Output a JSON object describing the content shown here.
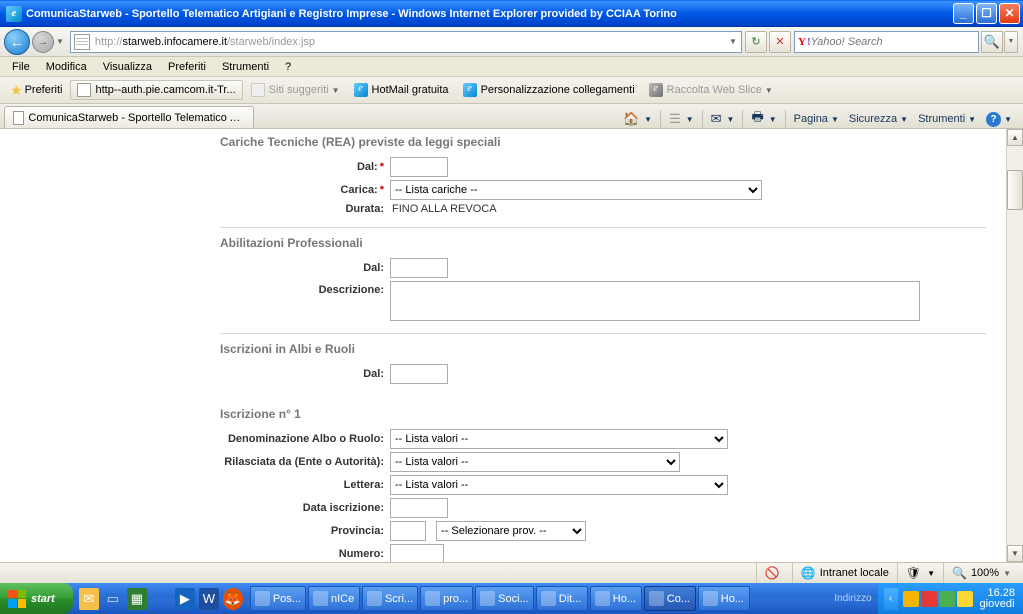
{
  "window": {
    "title": "ComunicaStarweb - Sportello Telematico Artigiani e Registro Imprese - Windows Internet Explorer provided by CCIAA Torino"
  },
  "address": {
    "scheme": "http://",
    "host": "starweb.infocamere.it",
    "path": "/starweb/index.jsp"
  },
  "search": {
    "placeholder": "Yahoo! Search"
  },
  "menu": {
    "file": "File",
    "modifica": "Modifica",
    "visualizza": "Visualizza",
    "preferiti": "Preferiti",
    "strumenti": "Strumenti",
    "help": "?"
  },
  "links": {
    "preferiti": "Preferiti",
    "auth": "http--auth.pie.camcom.it-Tr...",
    "siti": "Siti suggeriti",
    "hotmail": "HotMail gratuita",
    "pers": "Personalizzazione collegamenti",
    "raccolta": "Raccolta Web Slice"
  },
  "tab": {
    "label": "ComunicaStarweb - Sportello Telematico Artigiani e Re..."
  },
  "toolbar": {
    "pagina": "Pagina",
    "sicurezza": "Sicurezza",
    "strumenti": "Strumenti"
  },
  "form": {
    "sec1": "Cariche Tecniche (REA) previste da leggi speciali",
    "dal": "Dal:",
    "carica": "Carica:",
    "carica_opt": "-- Lista cariche --",
    "durata": "Durata:",
    "durata_val": "FINO ALLA REVOCA",
    "sec2": "Abilitazioni Professionali",
    "descrizione": "Descrizione:",
    "sec3": "Iscrizioni in Albi e Ruoli",
    "sec4": "Iscrizione n° 1",
    "denom": "Denominazione Albo o Ruolo:",
    "rilasciata": "Rilasciata da (Ente o Autorità):",
    "lettera": "Lettera:",
    "listavalori": "-- Lista valori --",
    "dataiscr": "Data iscrizione:",
    "provincia": "Provincia:",
    "selprov": "-- Selezionare prov. --",
    "numero": "Numero:"
  },
  "status": {
    "intranet": "Intranet locale",
    "zoom": "100%"
  },
  "taskbar": {
    "start": "start",
    "indirizzo": "Indirizzo",
    "tasks": [
      {
        "label": "Pos..."
      },
      {
        "label": "nICe"
      },
      {
        "label": "Scri..."
      },
      {
        "label": "pro..."
      },
      {
        "label": "Soci..."
      },
      {
        "label": "Dit..."
      },
      {
        "label": "Ho..."
      },
      {
        "label": "Co..."
      },
      {
        "label": "Ho..."
      }
    ],
    "time": "16.28",
    "day": "giovedì"
  }
}
